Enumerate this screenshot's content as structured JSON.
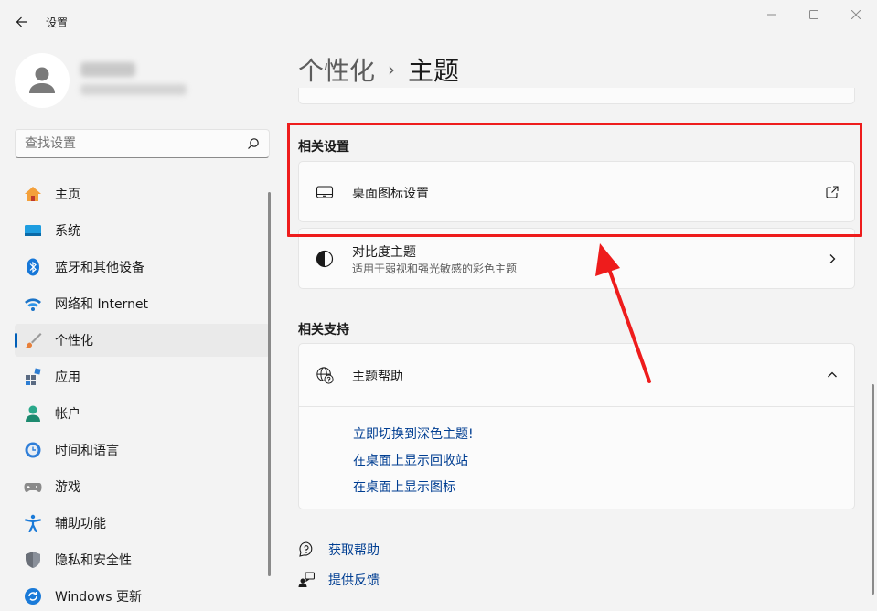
{
  "window": {
    "title": "设置",
    "controls": [
      "minimize",
      "maximize",
      "close"
    ]
  },
  "profile": {
    "name": "",
    "email": ""
  },
  "search": {
    "placeholder": "查找设置",
    "value": ""
  },
  "sidebar": {
    "items": [
      {
        "label": "主页",
        "icon": "home-icon",
        "selected": false
      },
      {
        "label": "系统",
        "icon": "system-icon",
        "selected": false
      },
      {
        "label": "蓝牙和其他设备",
        "icon": "bluetooth-icon",
        "selected": false
      },
      {
        "label": "网络和 Internet",
        "icon": "wifi-icon",
        "selected": false
      },
      {
        "label": "个性化",
        "icon": "brush-icon",
        "selected": true
      },
      {
        "label": "应用",
        "icon": "apps-icon",
        "selected": false
      },
      {
        "label": "帐户",
        "icon": "account-icon",
        "selected": false
      },
      {
        "label": "时间和语言",
        "icon": "time-language-icon",
        "selected": false
      },
      {
        "label": "游戏",
        "icon": "gaming-icon",
        "selected": false
      },
      {
        "label": "辅助功能",
        "icon": "accessibility-icon",
        "selected": false
      },
      {
        "label": "隐私和安全性",
        "icon": "shield-icon",
        "selected": false
      },
      {
        "label": "Windows 更新",
        "icon": "update-icon",
        "selected": false
      }
    ]
  },
  "breadcrumb": {
    "parent": "个性化",
    "separator": "›",
    "current": "主题"
  },
  "related_settings": {
    "title": "相关设置",
    "desktop_icons": {
      "label": "桌面图标设置",
      "icon": "monitor-icon",
      "trail": "external-link-icon"
    },
    "contrast": {
      "label": "对比度主题",
      "sub": "适用于弱视和强光敏感的彩色主题",
      "icon": "contrast-icon",
      "trail": "chevron-right-icon"
    }
  },
  "related_support": {
    "title": "相关支持",
    "help": {
      "label": "主题帮助",
      "icon": "globe-help-icon",
      "expanded": true,
      "links": [
        "立即切换到深色主题!",
        "在桌面上显示回收站",
        "在桌面上显示图标"
      ]
    }
  },
  "footer": {
    "get_help": "获取帮助",
    "feedback": "提供反馈"
  },
  "colors": {
    "accent": "#005fb8",
    "link": "#003e92",
    "annotation": "#ee1c1c",
    "background": "#f3f3f3",
    "card": "#fbfbfb"
  }
}
